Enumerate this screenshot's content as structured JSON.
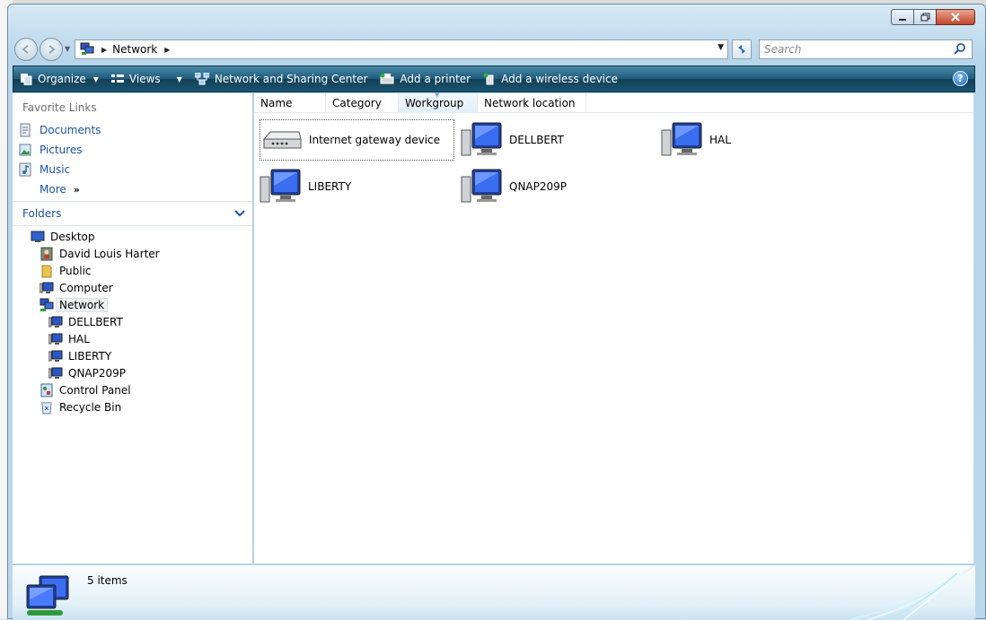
{
  "address": {
    "segment": "Network",
    "search_placeholder": "Search"
  },
  "toolbar": {
    "organize": "Organize",
    "views": "Views",
    "network_center": "Network and Sharing Center",
    "add_printer": "Add a printer",
    "add_wireless": "Add a wireless device",
    "help": "?"
  },
  "favorites": {
    "header": "Favorite Links",
    "items": [
      {
        "label": "Documents",
        "icon": "documents-icon"
      },
      {
        "label": "Pictures",
        "icon": "pictures-icon"
      },
      {
        "label": "Music",
        "icon": "music-icon"
      }
    ],
    "more": "More"
  },
  "folders": {
    "header": "Folders",
    "tree": [
      {
        "label": "Desktop",
        "icon": "desktop-icon"
      },
      {
        "label": "David Louis Harter",
        "icon": "user-folder-icon"
      },
      {
        "label": "Public",
        "icon": "folder-icon"
      },
      {
        "label": "Computer",
        "icon": "computer-icon"
      },
      {
        "label": "Network",
        "icon": "network-icon",
        "selected": true
      },
      {
        "label": "DELLBERT",
        "icon": "computer-icon"
      },
      {
        "label": "HAL",
        "icon": "computer-icon"
      },
      {
        "label": "LIBERTY",
        "icon": "computer-icon"
      },
      {
        "label": "QNAP209P",
        "icon": "computer-icon"
      },
      {
        "label": "Control Panel",
        "icon": "control-panel-icon"
      },
      {
        "label": "Recycle Bin",
        "icon": "recycle-bin-icon"
      }
    ]
  },
  "columns": [
    "Name",
    "Category",
    "Workgroup",
    "Network location"
  ],
  "items": [
    {
      "label": "Internet gateway device",
      "icon": "router-icon"
    },
    {
      "label": "DELLBERT",
      "icon": "computer-icon"
    },
    {
      "label": "HAL",
      "icon": "computer-icon"
    },
    {
      "label": "LIBERTY",
      "icon": "computer-icon"
    },
    {
      "label": "QNAP209P",
      "icon": "computer-icon"
    }
  ],
  "details": {
    "count": "5 items"
  },
  "colors": {
    "toolbar": "#1e5a7a",
    "link": "#1a52a5",
    "close": "#c2452c"
  }
}
